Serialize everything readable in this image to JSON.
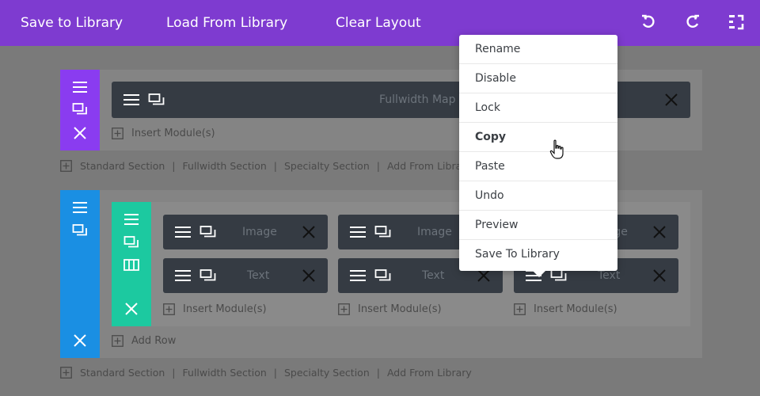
{
  "toolbar": {
    "save_to_library": "Save to Library",
    "load_from_library": "Load From Library",
    "clear_layout": "Clear Layout",
    "icons": [
      "undo-icon",
      "redo-icon",
      "portability-icon"
    ]
  },
  "section1": {
    "color": "#8a3cf0",
    "module_label": "Fullwidth Map",
    "insert_label": "Insert Module(s)"
  },
  "section_links": {
    "standard": "Standard Section",
    "fullwidth": "Fullwidth Section",
    "specialty": "Specialty Section",
    "add_from_library": "Add From Library",
    "separator": "|"
  },
  "section2": {
    "color": "#1a8fe3",
    "row_color": "#1cc9a0",
    "columns": [
      {
        "modules": [
          "Image",
          "Text"
        ],
        "insert_label": "Insert Module(s)"
      },
      {
        "modules": [
          "Image",
          "Text"
        ],
        "insert_label": "Insert Module(s)"
      },
      {
        "modules": [
          "Image",
          "Text"
        ],
        "insert_label": "Insert Module(s)"
      }
    ],
    "add_row": "Add Row"
  },
  "context_menu": {
    "items": [
      "Rename",
      "Disable",
      "Lock",
      "Copy",
      "Paste",
      "Undo",
      "Preview",
      "Save To Library"
    ],
    "hovered": "Copy"
  },
  "colors": {
    "topbar": "#7e3bd0",
    "module_bg": "#353b43",
    "overlay": "#7a7a7a"
  }
}
